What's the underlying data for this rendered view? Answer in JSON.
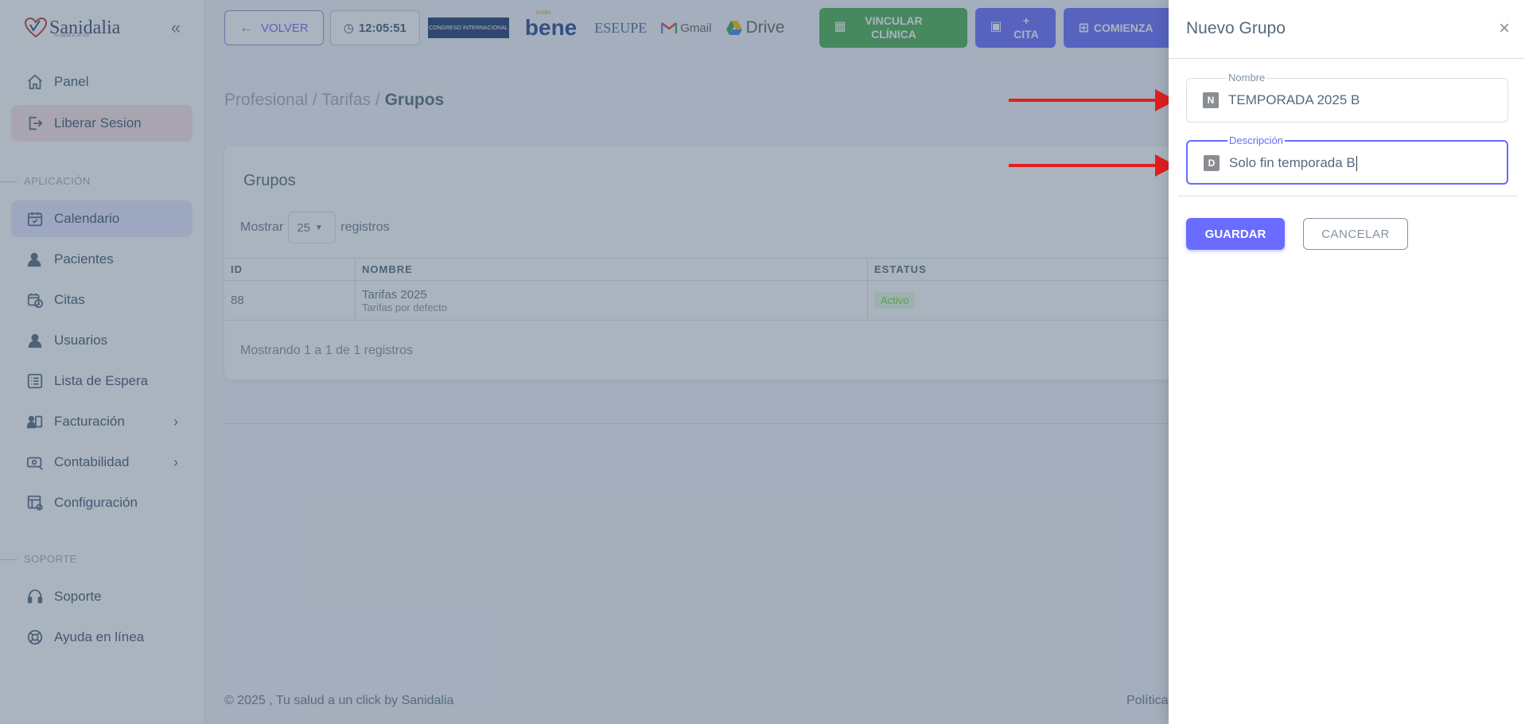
{
  "brand": {
    "name": "Sanidalia",
    "tagline": "tu salud a un clic"
  },
  "sidebar": {
    "items": [
      {
        "label": "Panel",
        "icon": "home-icon"
      },
      {
        "label": "Liberar Sesion",
        "icon": "logout-icon"
      },
      {
        "label": "Calendario",
        "icon": "calendar-check-icon"
      },
      {
        "label": "Pacientes",
        "icon": "patient-icon"
      },
      {
        "label": "Citas",
        "icon": "calendar-clock-icon"
      },
      {
        "label": "Usuarios",
        "icon": "user-icon"
      },
      {
        "label": "Lista de Espera",
        "icon": "list-icon"
      },
      {
        "label": "Facturación",
        "icon": "billing-icon"
      },
      {
        "label": "Contabilidad",
        "icon": "money-icon"
      },
      {
        "label": "Configuración",
        "icon": "settings-table-icon"
      },
      {
        "label": "Soporte",
        "icon": "headset-icon"
      },
      {
        "label": "Ayuda en línea",
        "icon": "lifebuoy-icon"
      }
    ],
    "section_app": "APLICACIÓN",
    "section_support": "SOPORTE"
  },
  "topbar": {
    "back_label": "VOLVER",
    "clock": "12:05:51",
    "congreso_label": "CONGRESO INTERNACIONAL",
    "bene_label": "bene",
    "bene_small": "estilo",
    "eseupe_label": "ESEUPE",
    "gmail_label": "Gmail",
    "drive_label": "Drive",
    "vincular_label": "VINCULAR CLÍNICA",
    "cita_label": "+ CITA",
    "comienza_label": "COMIENZA"
  },
  "breadcrumb": {
    "part1": "Profesional",
    "part2": "Tarifas",
    "current": "Grupos",
    "sep": " / "
  },
  "card": {
    "title": "Grupos",
    "show_prefix": "Mostrar",
    "show_value": "25",
    "show_suffix": "registros",
    "columns": [
      "ID",
      "NOMBRE",
      "ESTATUS"
    ],
    "rows": [
      {
        "id": "88",
        "name": "Tarifas 2025",
        "description": "Tarifas por defecto",
        "status": "Activo"
      }
    ],
    "footer": "Mostrando 1 a 1 de 1 registros"
  },
  "footer": {
    "copyright": "© 2025 , Tu salud a un click by Sanidalia",
    "right": "Política"
  },
  "panel": {
    "title": "Nuevo Grupo",
    "nombre_label": "Nombre",
    "nombre_icon": "N",
    "nombre_value": "TEMPORADA 2025 B",
    "descripcion_label": "Descripción",
    "descripcion_icon": "D",
    "descripcion_value": "Solo fin temporada B",
    "save_label": "GUARDAR",
    "cancel_label": "CANCELAR"
  },
  "colors": {
    "primary": "#696cff",
    "success": "#4caf50",
    "annotation": "#e01f1f"
  }
}
